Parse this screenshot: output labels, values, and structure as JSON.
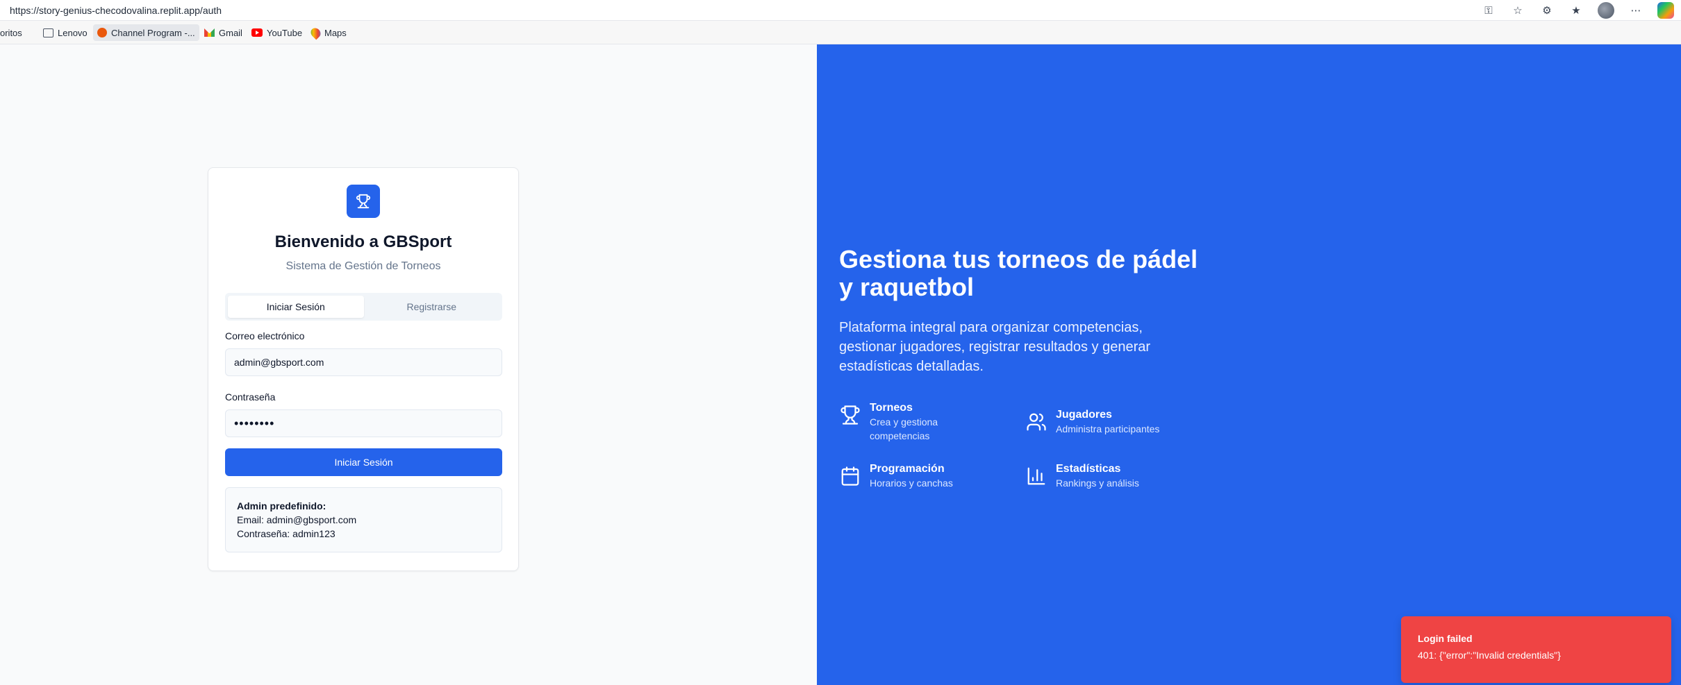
{
  "browser": {
    "url": "https://story-genius-checodovalina.replit.app/auth",
    "bookmarks": {
      "favorites": "oritos",
      "lenovo": "Lenovo",
      "channel": "Channel Program -...",
      "gmail": "Gmail",
      "youtube": "YouTube",
      "maps": "Maps"
    }
  },
  "login": {
    "title": "Bienvenido a GBSport",
    "subtitle": "Sistema de Gestión de Torneos",
    "tabs": {
      "login": "Iniciar Sesión",
      "register": "Registrarse"
    },
    "email_label": "Correo electrónico",
    "email_value": "admin@gbsport.com",
    "password_label": "Contraseña",
    "password_value": "••••••••",
    "submit": "Iniciar Sesión",
    "admin_box": {
      "heading": "Admin predefinido:",
      "email": "Email: admin@gbsport.com",
      "password": "Contraseña: admin123"
    }
  },
  "hero": {
    "title": "Gestiona tus torneos de pádel y raquetbol",
    "description": "Plataforma integral para organizar competencias, gestionar jugadores, registrar resultados y generar estadísticas detalladas.",
    "features": {
      "torneos": {
        "title": "Torneos",
        "desc": "Crea y gestiona competencias"
      },
      "jugadores": {
        "title": "Jugadores",
        "desc": "Administra participantes"
      },
      "programacion": {
        "title": "Programación",
        "desc": "Horarios y canchas"
      },
      "estadisticas": {
        "title": "Estadísticas",
        "desc": "Rankings y análisis"
      }
    }
  },
  "toast": {
    "title": "Login failed",
    "message": "401: {\"error\":\"Invalid credentials\"}"
  },
  "colors": {
    "brand_blue": "#2563eb",
    "toast_red": "#ef4444"
  }
}
